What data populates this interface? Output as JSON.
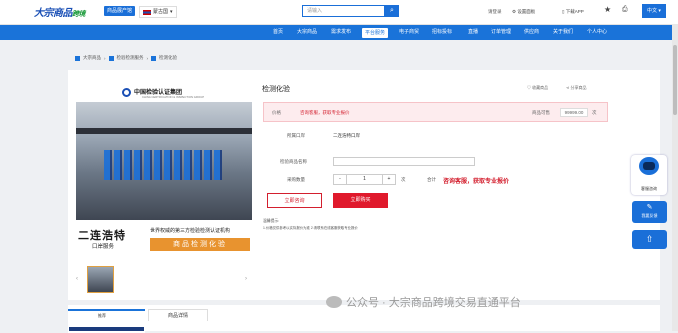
{
  "header": {
    "logo_text": "大宗商品",
    "logo_sub": "跨境",
    "category_tag": "商品展产馆",
    "country": "蒙古国",
    "search_placeholder": "请输入",
    "search_icon": "search-icon",
    "login": "请登录",
    "settings": "设置面板",
    "download": "下载APP",
    "lang": "中文"
  },
  "nav": {
    "items": [
      "首页",
      "大宗商品",
      "需求发布",
      "平台服务",
      "电子商贸",
      "招标投标",
      "直播",
      "订单管理",
      "供应商",
      "关于我们",
      "个人中心"
    ],
    "active_index": 3
  },
  "breadcrumb": [
    "大宗商品",
    "检验检测服务",
    "检测化验"
  ],
  "product": {
    "image_logo": "中国检验认证集团",
    "image_logo_sub": "CHINA CERTIFICATION & INSPECTION GROUP",
    "image_place": "二连浩特",
    "image_place_sub": "口岸服务",
    "image_slogan": "世界权威的第三方检验检测认证机构",
    "image_banner": "商品检测化验",
    "title": "检测化验",
    "favorite": "收藏商品",
    "share": "分享商品",
    "price_label": "价格",
    "price_value": "咨询客服，获取专业报价",
    "stock_label": "商品可售",
    "stock_value": "99999.00",
    "stock_unit": "次",
    "location_label": "所属口岸",
    "location_value": "二连浩特口岸",
    "goods_name_label": "检验商品名称",
    "qty_label": "采购数量",
    "qty_minus": "-",
    "qty_value": "1",
    "qty_plus": "+",
    "qty_unit": "次",
    "total_label": "合计",
    "total_value": "咨询客服，获取专业报价",
    "consult_button": "立即咨询",
    "buy_button": "立即购买",
    "tip_title": "温馨提示:",
    "tip_body": "1.价格仅供参考以实际报价为准 2.请联系在线客服获取专业报价"
  },
  "tabs": {
    "left_label": "推荐",
    "detail": "商品详情"
  },
  "watermark": "公众号 · 大宗商品跨境交易直通平台",
  "float": {
    "service": "客服咨询",
    "feedback": "我要反馈",
    "top_icon": "arrow-up-icon"
  },
  "colors": {
    "primary": "#1a73d9",
    "accent_red": "#d31f2e",
    "banner_orange": "#e8932f"
  }
}
